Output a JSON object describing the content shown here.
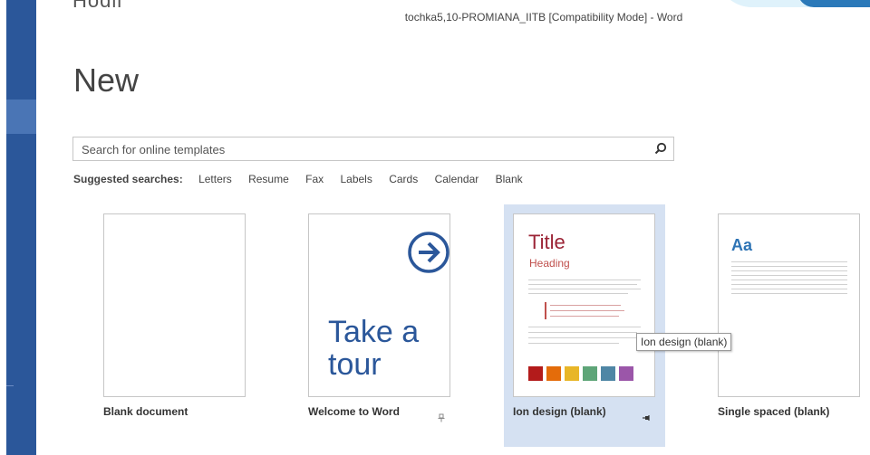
{
  "window": {
    "title": "tochka5,10-PROMIANA_IITB [Compatibility Mode] - Word",
    "cropped_heading": "Hodli"
  },
  "page": {
    "title": "New"
  },
  "search": {
    "placeholder": "Search for online templates",
    "value": ""
  },
  "suggested": {
    "label": "Suggested searches:",
    "items": [
      "Letters",
      "Resume",
      "Fax",
      "Labels",
      "Cards",
      "Calendar",
      "Blank"
    ]
  },
  "templates": [
    {
      "name": "Blank document"
    },
    {
      "name": "Welcome to Word",
      "preview_text_1": "Take a",
      "preview_text_2": "tour",
      "icon": "arrow-right-circle-icon"
    },
    {
      "name": "Ion design (blank)",
      "preview_title": "Title",
      "preview_heading": "Heading",
      "selected": true
    },
    {
      "name": "Single spaced (blank)",
      "preview_title": "Aa"
    }
  ],
  "tooltip": {
    "text": "Ion design (blank)"
  },
  "colors": {
    "accent": "#2b579a",
    "ion_swatches": [
      "#b31b1b",
      "#e46c0a",
      "#e8b628",
      "#5ea578",
      "#4f86a5",
      "#9b56a9"
    ]
  }
}
